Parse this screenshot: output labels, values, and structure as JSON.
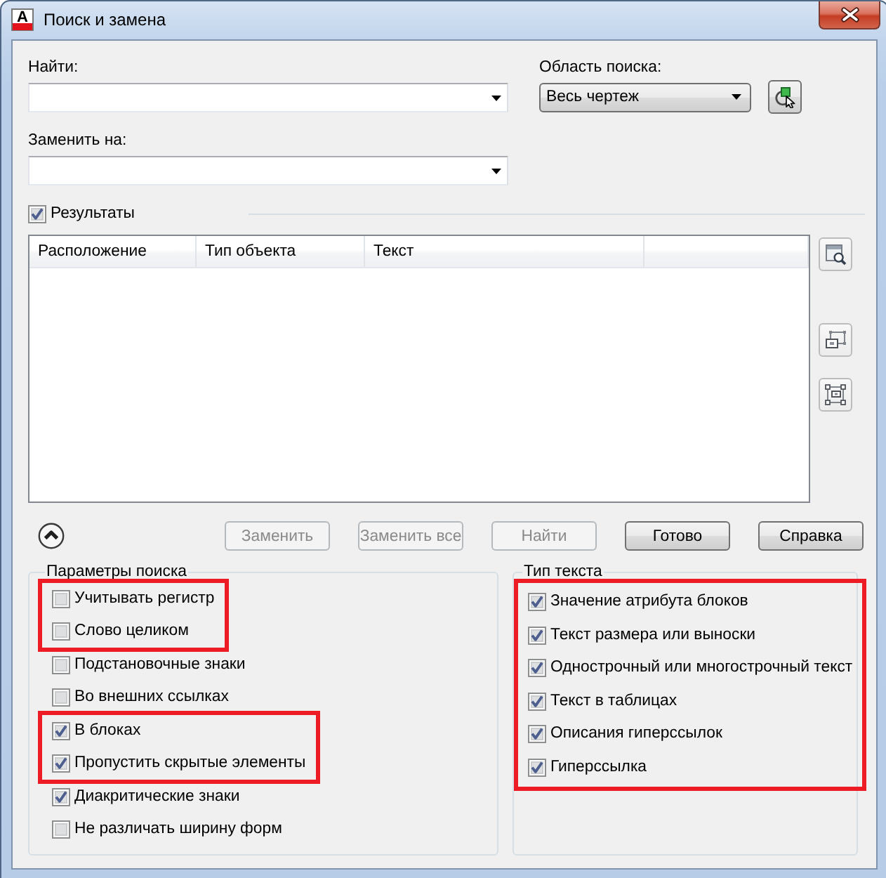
{
  "window": {
    "icon_text": "A",
    "title": "Поиск и замена"
  },
  "find": {
    "label": "Найти:"
  },
  "search_scope": {
    "label": "Область поиска:",
    "value": "Весь чертеж"
  },
  "replace": {
    "label": "Заменить на:"
  },
  "results": {
    "label": "Результаты",
    "checked": true,
    "columns": [
      "Расположение",
      "Тип объекта",
      "Текст"
    ]
  },
  "options_toggle": {
    "expanded": true
  },
  "buttons": [
    {
      "label": "Заменить",
      "disabled": true
    },
    {
      "label": "Заменить все",
      "disabled": true
    },
    {
      "label": "Найти",
      "disabled": true
    },
    {
      "label": "Готово",
      "disabled": false
    },
    {
      "label": "Справка",
      "disabled": false
    }
  ],
  "search_options": {
    "title": "Параметры поиска",
    "item_groups": [
      {
        "highlighted": true,
        "items": [
          {
            "label": "Учитывать регистр",
            "checked": false
          },
          {
            "label": "Слово целиком",
            "checked": false
          }
        ]
      },
      {
        "highlighted": false,
        "items": [
          {
            "label": "Подстановочные знаки",
            "checked": false
          },
          {
            "label": "Во внешних ссылках",
            "checked": false
          }
        ]
      },
      {
        "highlighted": true,
        "items": [
          {
            "label": "В блоках",
            "checked": true
          },
          {
            "label": "Пропустить скрытые элементы",
            "checked": true
          }
        ]
      },
      {
        "highlighted": false,
        "items": [
          {
            "label": "Диакритические знаки",
            "checked": true
          },
          {
            "label": "Не различать ширину форм",
            "checked": false
          }
        ]
      }
    ]
  },
  "text_types": {
    "title": "Тип текста",
    "item_groups": [
      {
        "highlighted": true,
        "items": [
          {
            "label": "Значение атрибута блоков",
            "checked": true
          },
          {
            "label": "Текст размера или выноски",
            "checked": true
          },
          {
            "label": "Однострочный или многострочный текст",
            "checked": true
          },
          {
            "label": "Текст в таблицах",
            "checked": true
          },
          {
            "label": "Описания гиперссылок",
            "checked": true
          },
          {
            "label": "Гиперссылка",
            "checked": true
          }
        ]
      }
    ]
  }
}
